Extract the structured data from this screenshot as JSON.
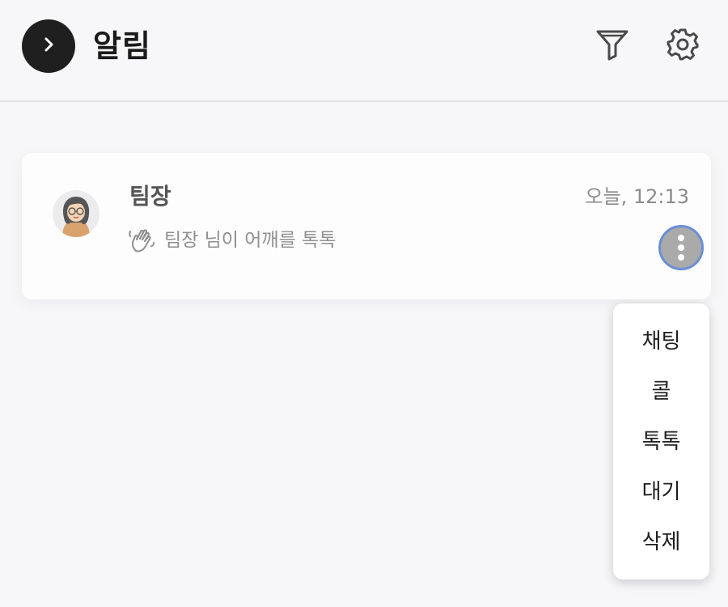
{
  "header": {
    "title": "알림",
    "back_icon": "chevron-right-icon",
    "filter_icon": "filter-icon",
    "settings_icon": "gear-icon"
  },
  "notification": {
    "sender": "팀장",
    "time": "오늘, 12:13",
    "message": "팀장 님이 어깨를 톡톡",
    "message_icon": "waving-hand-icon",
    "more_icon": "more-vertical-icon"
  },
  "menu": {
    "items": [
      "채팅",
      "콜",
      "톡톡",
      "대기",
      "삭제"
    ]
  },
  "colors": {
    "background": "#f7f7f9",
    "back_button": "#1f1f1f",
    "more_button": "#aaaaaa",
    "focus_ring": "#6a8fd6"
  }
}
